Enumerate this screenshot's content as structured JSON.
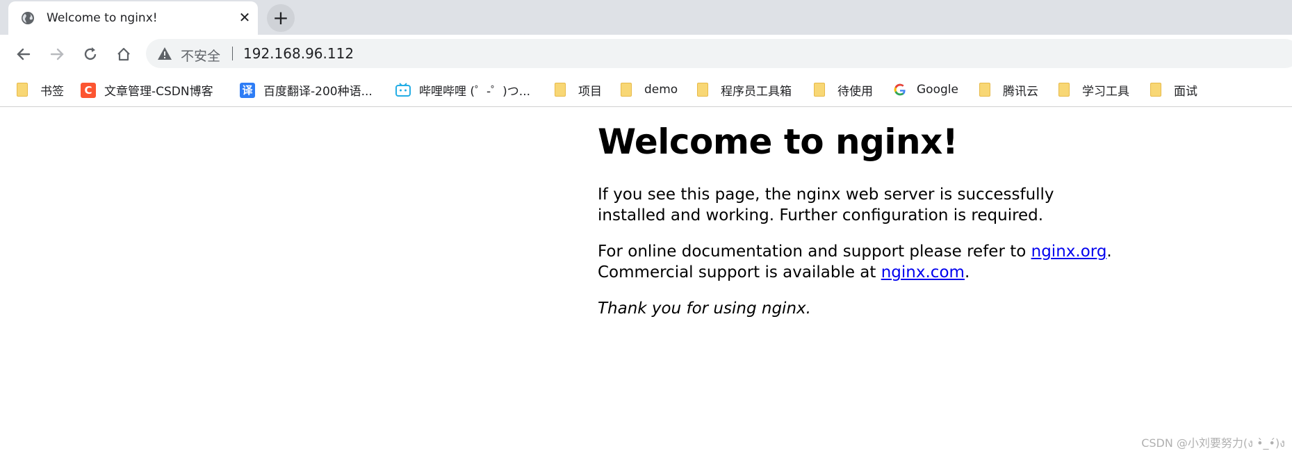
{
  "tab": {
    "title": "Welcome to nginx!",
    "close_glyph": "✕",
    "favicon": "globe-icon"
  },
  "newtab": {
    "glyph": "+"
  },
  "toolbar": {
    "back_icon": "arrow-left-icon",
    "forward_icon": "arrow-right-icon",
    "reload_icon": "reload-icon",
    "home_icon": "home-icon"
  },
  "omnibox": {
    "security_label": "不安全",
    "url": "192.168.96.112"
  },
  "bookmarks": [
    {
      "label": "书签",
      "icon": "folder"
    },
    {
      "label": "文章管理-CSDN博客",
      "icon": "csdn",
      "badge": "C",
      "color": "#fc5531"
    },
    {
      "label": "百度翻译-200种语...",
      "icon": "baidu-translate",
      "badge": "译",
      "color": "#2e7df6"
    },
    {
      "label": "哔哩哔哩 (゜-゜)つ...",
      "icon": "bilibili"
    },
    {
      "label": "项目",
      "icon": "folder"
    },
    {
      "label": "demo",
      "icon": "folder"
    },
    {
      "label": "程序员工具箱",
      "icon": "folder"
    },
    {
      "label": "待使用",
      "icon": "folder"
    },
    {
      "label": "Google",
      "icon": "google"
    },
    {
      "label": "腾讯云",
      "icon": "folder"
    },
    {
      "label": "学习工具",
      "icon": "folder"
    },
    {
      "label": "面试",
      "icon": "folder"
    }
  ],
  "page": {
    "heading": "Welcome to nginx!",
    "p1": "If you see this page, the nginx web server is successfully installed and working. Further configuration is required.",
    "p2_before": "For online documentation and support please refer to ",
    "link_org": "nginx.org",
    "p2_mid": ".",
    "p2_line2": "Commercial support is available at ",
    "link_com": "nginx.com",
    "p2_end": ".",
    "p3": "Thank you for using nginx."
  },
  "watermark": "CSDN @小刘要努力(ง •̀_•́)ง",
  "colors": {
    "tabstrip": "#dee1e6",
    "link": "#0000ee",
    "folder": "#f8d775"
  }
}
